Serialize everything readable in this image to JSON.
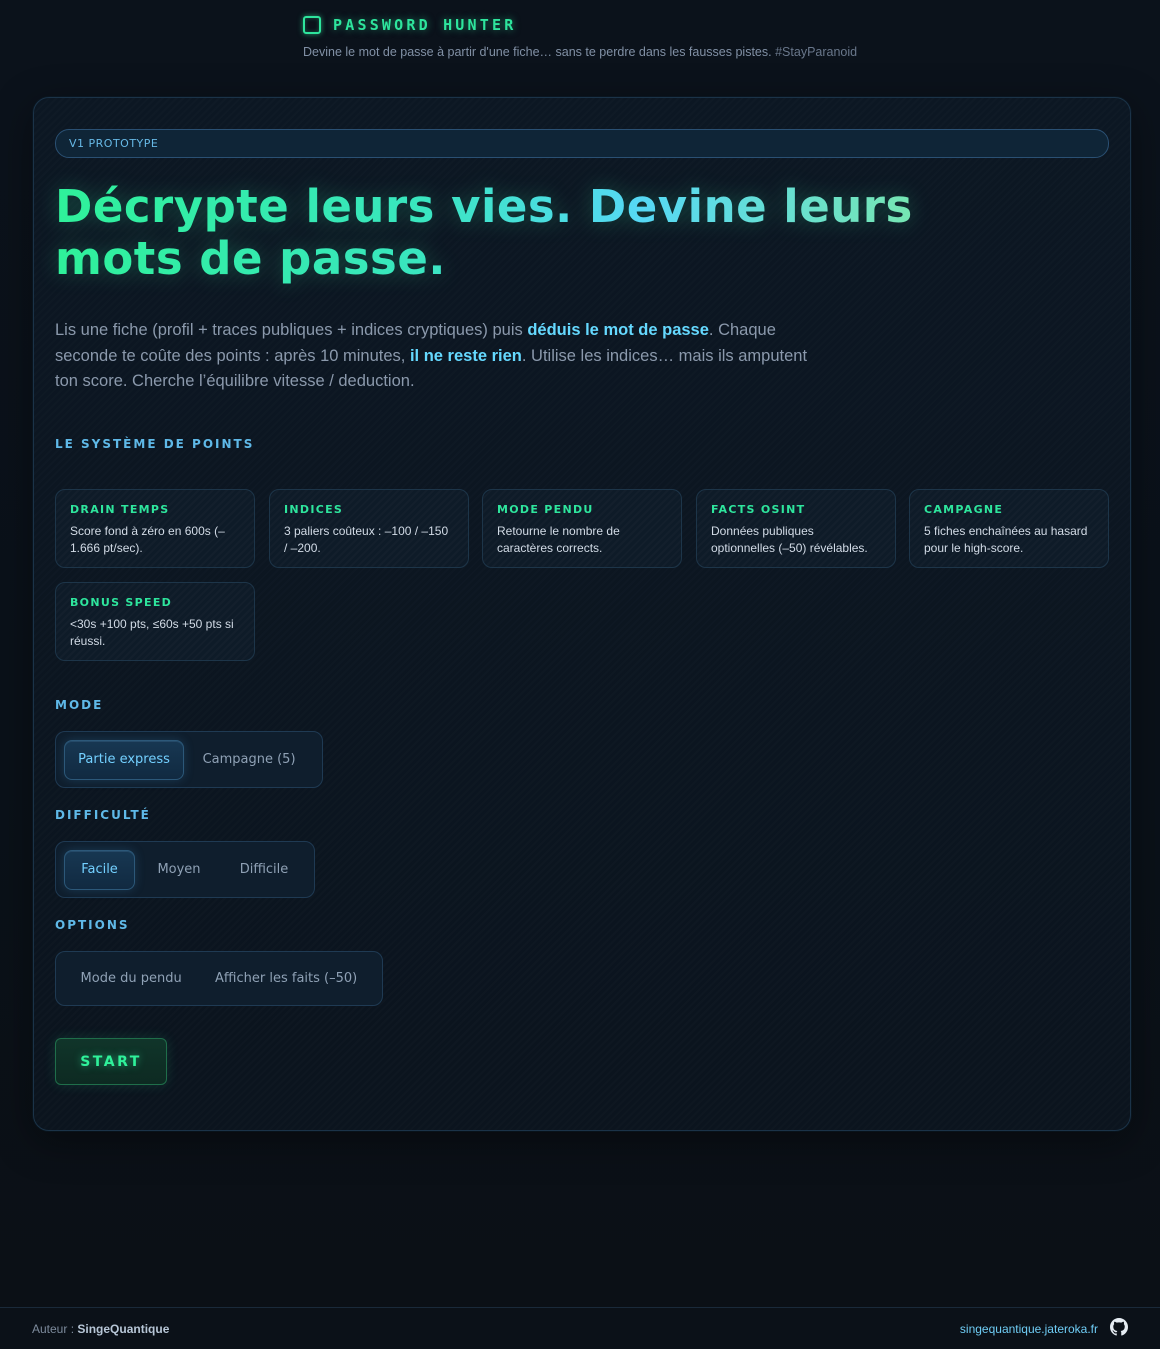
{
  "header": {
    "title": "PASSWORD HUNTER",
    "tagline": "Devine le mot de passe à partir d'une fiche… sans te perdre dans les fausses pistes.",
    "hashtag": "#StayParanoid"
  },
  "badge": "V1 PROTOTYPE",
  "hero": {
    "line1": "Décrypte leurs vies. Devine leurs",
    "line2": "mots de passe."
  },
  "lead": {
    "p1": "Lis une fiche (profil + traces publiques + indices cryptiques) puis ",
    "b1": "déduis le mot de passe",
    "p2": ". Chaque seconde te coûte des points : après 10 minutes, ",
    "b2": "il ne reste rien",
    "p3": ". Utilise les indices… mais ils amputent ton score. Cherche l’équilibre vitesse / deduction."
  },
  "points_section": {
    "label": "LE SYSTÈME DE POINTS",
    "tiles": [
      {
        "title": "DRAIN TEMPS",
        "desc": "Score fond à zéro en 600s (–1.666 pt/sec)."
      },
      {
        "title": "INDICES",
        "desc": "3 paliers coûteux : –100 / –150 / –200."
      },
      {
        "title": "MODE PENDU",
        "desc": "Retourne le nombre de caractères corrects."
      },
      {
        "title": "FACTS OSINT",
        "desc": "Données publiques optionnelles (–50) révélables."
      },
      {
        "title": "CAMPAGNE",
        "desc": "5 fiches enchaînées au hasard pour le high-score."
      },
      {
        "title": "BONUS SPEED",
        "desc": "<30s +100 pts, ≤60s +50 pts si réussi."
      }
    ]
  },
  "mode": {
    "label": "MODE",
    "options": [
      "Partie express",
      "Campagne (5)"
    ],
    "selected": "Partie express"
  },
  "difficulty": {
    "label": "DIFFICULTÉ",
    "options": [
      "Facile",
      "Moyen",
      "Difficile"
    ],
    "selected": "Facile"
  },
  "options": {
    "label": "OPTIONS",
    "items": [
      "Mode du pendu",
      "Afficher les faits (–50)"
    ]
  },
  "start_label": "START",
  "footer": {
    "author_prefix": "Auteur : ",
    "author": "SingeQuantique",
    "site": "singequantique.jateroka.fr",
    "github_icon": "github-icon"
  },
  "colors": {
    "accent_green": "#2ee59d",
    "accent_cyan": "#56d8f5",
    "background": "#0a1119"
  }
}
